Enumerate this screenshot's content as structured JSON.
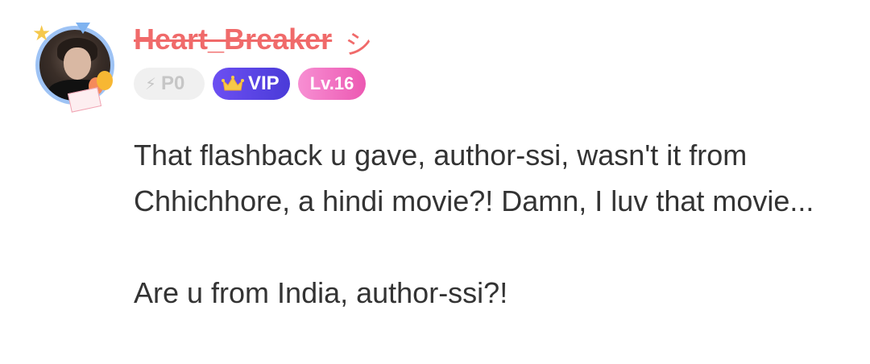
{
  "user": {
    "name": "Heart_Breaker",
    "name_suffix": "シ",
    "avatar": "avatar-image",
    "name_color": "#f06a6a"
  },
  "badges": {
    "points": {
      "icon": "bolt-icon",
      "label": "P0"
    },
    "vip": {
      "icon": "crown-icon",
      "label": "VIP"
    },
    "level": {
      "label": "Lv.16"
    }
  },
  "comment": {
    "paragraph1": "That flashback u gave, author-ssi, wasn't it from Chhichhore, a hindi movie?! Damn, I luv that movie...",
    "paragraph2": "Are u from India, author-ssi?!"
  },
  "colors": {
    "vip_badge": "#5a45e6",
    "level_badge": "#f06bc3",
    "points_badge": "#f0f0f0",
    "avatar_ring": "#9ec3f5"
  }
}
